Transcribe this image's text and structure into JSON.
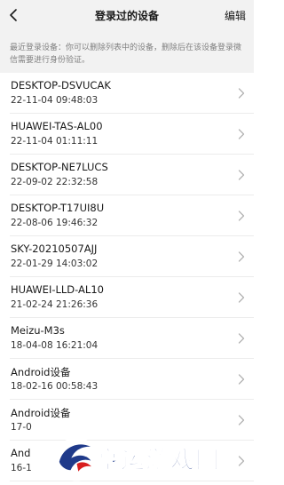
{
  "header": {
    "title": "登录过的设备",
    "edit_label": "编辑"
  },
  "notice": "最近登录设备：你可以删除列表中的设备，删除后在该设备登录微信需要进行身份验证。",
  "devices": [
    {
      "name": "DESKTOP-DSVUCAK",
      "time": "22-11-04 09:48:03"
    },
    {
      "name": "HUAWEI-TAS-AL00",
      "time": "22-11-04 01:11:11"
    },
    {
      "name": "DESKTOP-NE7LUCS",
      "time": "22-09-02 22:32:58"
    },
    {
      "name": "DESKTOP-T17UI8U",
      "time": "22-08-06 19:46:32"
    },
    {
      "name": "SKY-20210507AJJ",
      "time": "22-01-29 14:03:02"
    },
    {
      "name": "HUAWEI-LLD-AL10",
      "time": "21-02-24 21:26:36"
    },
    {
      "name": "Meizu-M3s",
      "time": "18-04-08 16:21:04"
    },
    {
      "name": "Android设备",
      "time": "18-02-16 00:58:43"
    },
    {
      "name": "Android设备",
      "time": "17-0"
    },
    {
      "name": "And",
      "time": "16-1"
    }
  ],
  "watermark": {
    "text": "亨运游戏网"
  },
  "colors": {
    "header_bg": "#f2f2f2",
    "notice_text": "#808080",
    "divider": "#ececec",
    "chevron": "#b3b3b3",
    "watermark_text": "#1f3a8a",
    "watermark_accent": "#d81e1e"
  },
  "icons": {
    "back": "chevron-left-icon",
    "row": "chevron-right-icon"
  }
}
